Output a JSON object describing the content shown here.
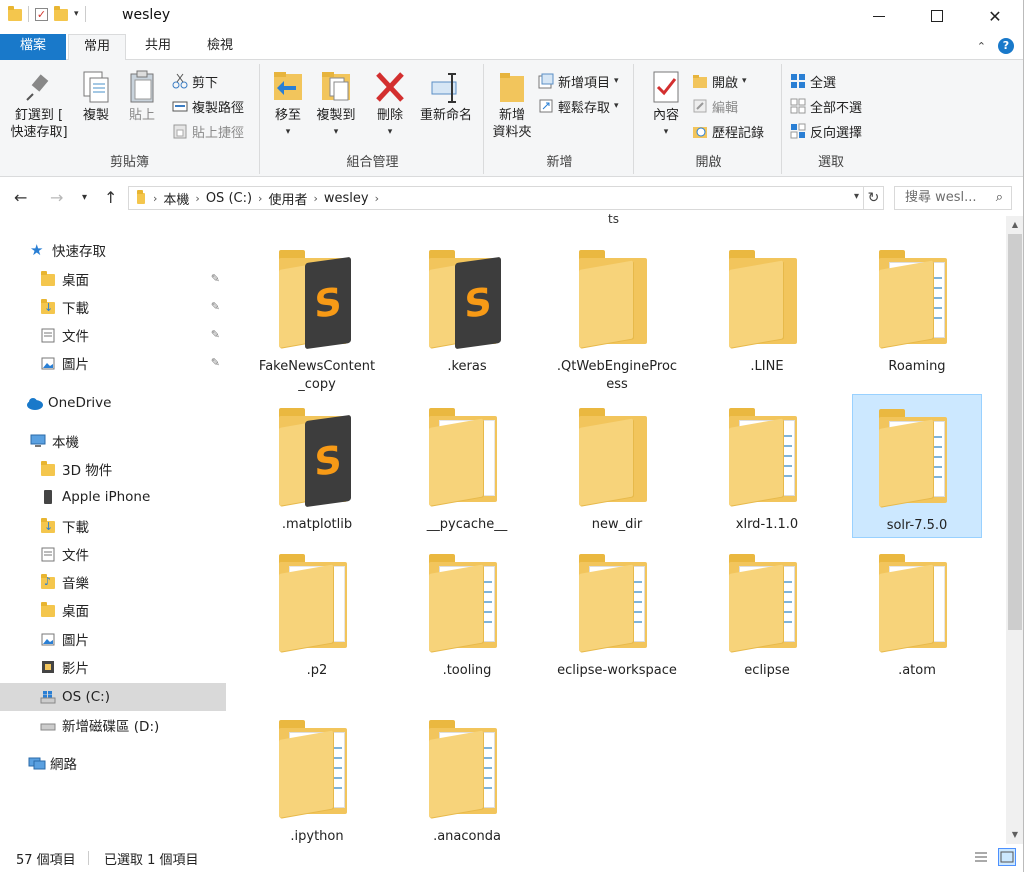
{
  "window": {
    "title": "wesley",
    "minimize_label": "—",
    "close_label": "✕"
  },
  "ribbon_tabs": {
    "file": "檔案",
    "home": "常用",
    "share": "共用",
    "view": "檢視"
  },
  "ribbon": {
    "clipboard": {
      "label": "剪貼簿",
      "pin_quick": "釘選到 [",
      "pin_quick2": "快速存取]",
      "copy": "複製",
      "paste": "貼上",
      "cut": "剪下",
      "copy_path": "複製路徑",
      "paste_shortcut": "貼上捷徑"
    },
    "organize": {
      "label": "組合管理",
      "move_to": "移至",
      "copy_to": "複製到",
      "delete": "刪除",
      "rename": "重新命名"
    },
    "new": {
      "label": "新增",
      "new_folder": "新增",
      "new_folder2": "資料夾",
      "new_item": "新增項目",
      "easy_access": "輕鬆存取"
    },
    "open": {
      "label": "開啟",
      "properties": "內容",
      "open": "開啟",
      "edit": "編輯",
      "history": "歷程記錄"
    },
    "select": {
      "label": "選取",
      "select_all": "全選",
      "select_none": "全部不選",
      "invert": "反向選擇"
    }
  },
  "address": {
    "crumbs": [
      "本機",
      "OS (C:)",
      "使用者",
      "wesley"
    ],
    "search_placeholder": "搜尋 wesl..."
  },
  "nav_pane": {
    "quick_access": "快速存取",
    "qa_items": [
      "桌面",
      "下載",
      "文件",
      "圖片"
    ],
    "onedrive": "OneDrive",
    "this_pc": "本機",
    "pc_items": [
      "3D 物件",
      "Apple iPhone",
      "下載",
      "文件",
      "音樂",
      "桌面",
      "圖片",
      "影片",
      "OS (C:)",
      "新增磁碟區 (D:)"
    ],
    "network": "網路"
  },
  "content": {
    "top_partial": "ts",
    "items": [
      {
        "name": "FakeNewsContent_copy",
        "kind": "sublime"
      },
      {
        "name": ".keras",
        "kind": "sublime"
      },
      {
        "name": ".QtWebEngineProcess",
        "kind": "empty"
      },
      {
        "name": ".LINE",
        "kind": "empty"
      },
      {
        "name": "Roaming",
        "kind": "docs"
      },
      {
        "name": ".matplotlib",
        "kind": "sublime"
      },
      {
        "name": "__pycache__",
        "kind": "paper"
      },
      {
        "name": "new_dir",
        "kind": "empty"
      },
      {
        "name": "xlrd-1.1.0",
        "kind": "docs"
      },
      {
        "name": "solr-7.5.0",
        "kind": "docs"
      },
      {
        "name": ".p2",
        "kind": "paper"
      },
      {
        "name": ".tooling",
        "kind": "docs"
      },
      {
        "name": "eclipse-workspace",
        "kind": "docs"
      },
      {
        "name": "eclipse",
        "kind": "docs"
      },
      {
        "name": ".atom",
        "kind": "paper"
      },
      {
        "name": ".ipython",
        "kind": "docs"
      },
      {
        "name": ".anaconda",
        "kind": "docs"
      }
    ]
  },
  "status": {
    "count": "57 個項目",
    "selected": "已選取 1 個項目"
  },
  "colors": {
    "accent": "#1979ca",
    "selection": "#cce8ff",
    "folder": "#f2c55c"
  }
}
